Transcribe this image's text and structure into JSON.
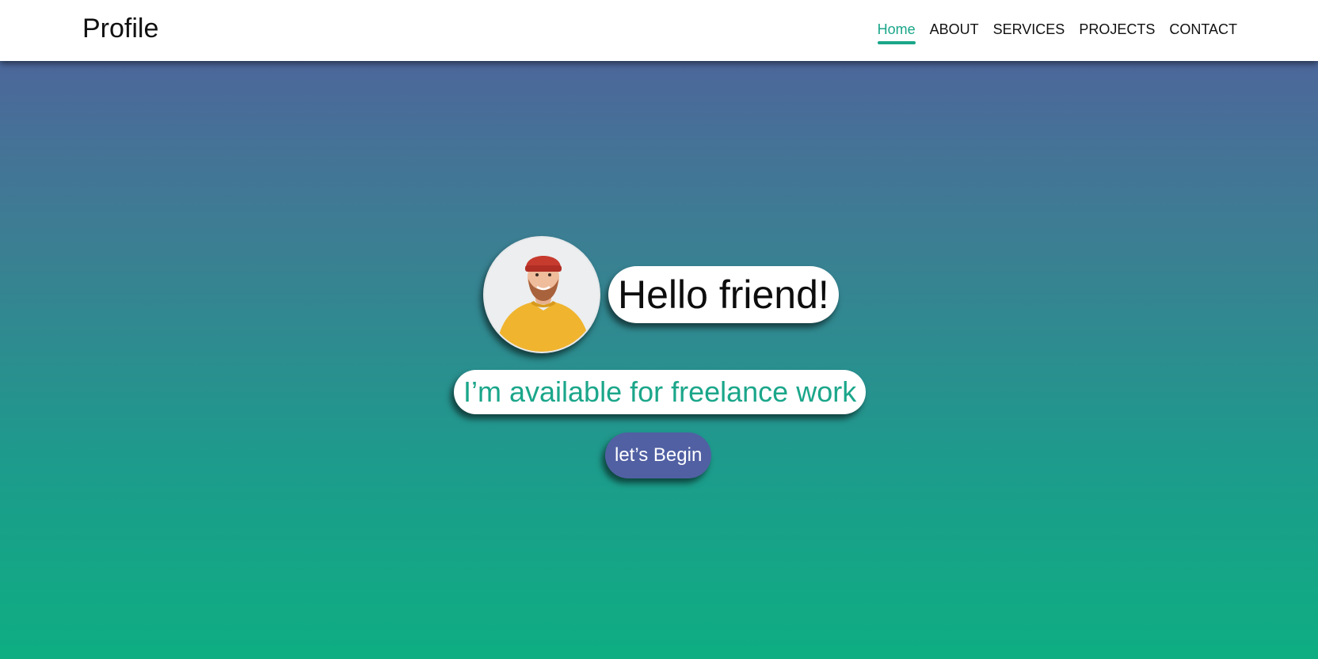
{
  "navbar": {
    "brand": "Profile",
    "items": [
      {
        "label": "Home",
        "active": true
      },
      {
        "label": "ABOUT",
        "active": false
      },
      {
        "label": "SERVICES",
        "active": false
      },
      {
        "label": "PROJECTS",
        "active": false
      },
      {
        "label": "CONTACT",
        "active": false
      }
    ]
  },
  "hero": {
    "avatar_icon": "person-portrait-icon",
    "greeting": "Hello friend!",
    "tagline": "I’m available for freelance work",
    "cta_label": "let’s Begin"
  },
  "colors": {
    "accent": "#1ba68a",
    "button": "#5160a3",
    "gradient_top": "#525f9e",
    "gradient_bottom": "#0eae82",
    "navbar_bg": "#ffffff"
  }
}
